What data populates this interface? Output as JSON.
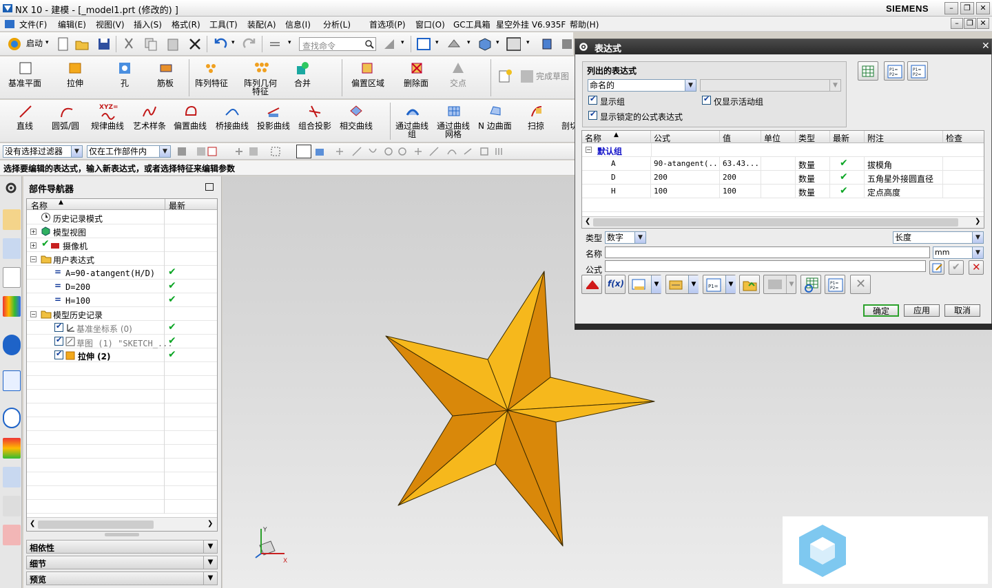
{
  "titlebar": {
    "title": "NX 10 - 建模 - [_model1.prt  (修改的) ]",
    "brand": "SIEMENS",
    "min": "–",
    "restore": "❐",
    "close": "✕"
  },
  "menubar": {
    "items": [
      "文件(F)",
      "编辑(E)",
      "视图(V)",
      "插入(S)",
      "格式(R)",
      "工具(T)",
      "装配(A)",
      "信息(I)",
      "分析(L)",
      "首选项(P)",
      "窗口(O)",
      "GC工具箱",
      "星空外挂 V6.935F",
      "帮助(H)"
    ]
  },
  "toolbar1": {
    "start_label": "启动",
    "search_placeholder": "查找命令"
  },
  "toolbar2": {
    "items": [
      "基准平面",
      "拉伸",
      "孔",
      "筋板",
      "阵列特征",
      "阵列几何",
      "特征",
      "合并",
      "偏置区域",
      "删除面",
      "交点",
      "完成草图"
    ]
  },
  "toolbar3": {
    "items": [
      "直线",
      "圆弧/圆",
      "规律曲线",
      "艺术样条",
      "偏置曲线",
      "桥接曲线",
      "投影曲线",
      "组合投影",
      "相交曲线",
      "通过曲线",
      "组",
      "通过曲线",
      "网格",
      "N 边曲面",
      "扫掠",
      "剖切"
    ],
    "xyz": "XYZ="
  },
  "selectionbar": {
    "filter": "没有选择过滤器",
    "scope": "仅在工作部件内"
  },
  "statusline": "选择要编辑的表达式，输入新表达式，或者选择特征来编辑参数",
  "partnav": {
    "title": "部件导航器",
    "col_name": "名称",
    "col_latest": "最新",
    "rows": [
      {
        "text": "历史记录模式"
      },
      {
        "text": "模型视图"
      },
      {
        "text": "摄像机"
      },
      {
        "text": "用户表达式"
      },
      {
        "text": "A=90-atangent(H/D)"
      },
      {
        "text": "D=200"
      },
      {
        "text": "H=100"
      },
      {
        "text": "模型历史记录"
      },
      {
        "text": "基准坐标系 (0)"
      },
      {
        "text": "草图 (1) \"SKETCH_..."
      },
      {
        "text": "拉伸 (2)"
      }
    ],
    "accordions": [
      "相依性",
      "细节",
      "预览"
    ]
  },
  "dialog": {
    "title": "表达式",
    "group_title": "列出的表达式",
    "listed_select": "命名的",
    "show_group": "显示组",
    "only_active": "仅显示活动组",
    "show_locked": "显示锁定的公式表达式",
    "columns": [
      "名称",
      "公式",
      "值",
      "单位",
      "类型",
      "最新",
      "附注",
      "检查"
    ],
    "group_row": "默认组",
    "rows": [
      {
        "name": "A",
        "formula": "90-atangent(...",
        "value": "63.43...",
        "unit": "",
        "type": "数量",
        "note": "拔模角"
      },
      {
        "name": "D",
        "formula": "200",
        "value": "200",
        "unit": "",
        "type": "数量",
        "note": "五角星外接圆直径"
      },
      {
        "name": "H",
        "formula": "100",
        "value": "100",
        "unit": "",
        "type": "数量",
        "note": "定点高度"
      }
    ],
    "type_label": "类型",
    "type_value": "数字",
    "dimension_value": "长度",
    "name_label": "名称",
    "unit_value": "mm",
    "formula_label": "公式",
    "ok": "确定",
    "apply": "应用",
    "cancel": "取消"
  },
  "colors": {
    "star_light": "#f6b81c",
    "star_dark": "#d9880a",
    "check_green": "#0aa524",
    "group_blue": "#1010c8"
  }
}
